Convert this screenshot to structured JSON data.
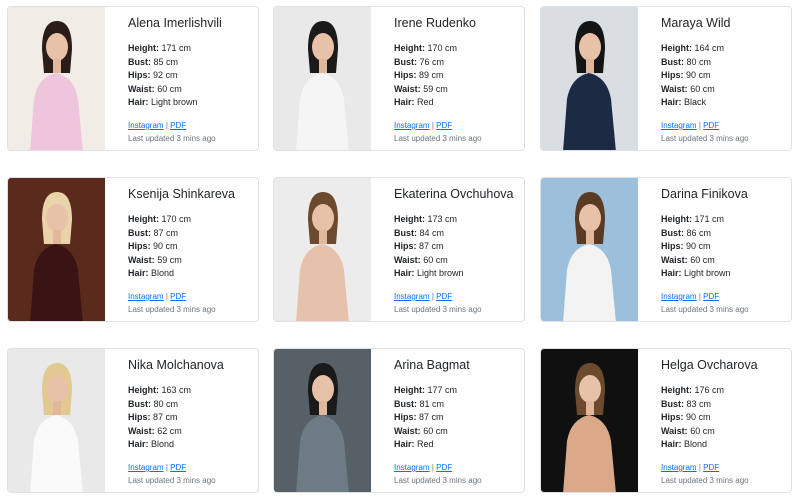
{
  "labels": {
    "height": "Height:",
    "bust": "Bust:",
    "hips": "Hips:",
    "waist": "Waist:",
    "hair": "Hair:",
    "instagram": "Instagram",
    "pdf": "PDF",
    "separator": "|"
  },
  "models": [
    {
      "name": "Alena Imerlishvili",
      "height": "171 cm",
      "bust": "85 cm",
      "hips": "92 cm",
      "waist": "60 cm",
      "hair": "Light brown",
      "updated": "Last updated 3 mins ago",
      "photo_bg": "#f1ece6",
      "photo_fg": "#efc5dd",
      "photo_hair": "#2a1d18"
    },
    {
      "name": "Irene Rudenko",
      "height": "170 cm",
      "bust": "76 cm",
      "hips": "89 cm",
      "waist": "59 cm",
      "hair": "Red",
      "updated": "Last updated 3 mins ago",
      "photo_bg": "#e9e9e9",
      "photo_fg": "#f5f5f5",
      "photo_hair": "#1a1a1a"
    },
    {
      "name": "Maraya Wild",
      "height": "164 cm",
      "bust": "80 cm",
      "hips": "90 cm",
      "waist": "60 cm",
      "hair": "Black",
      "updated": "Last updated 3 mins ago",
      "photo_bg": "#d9dee2",
      "photo_fg": "#1d2a44",
      "photo_hair": "#141414"
    },
    {
      "name": "Ksenija Shinkareva",
      "height": "170 cm",
      "bust": "87 cm",
      "hips": "90 cm",
      "waist": "59 cm",
      "hair": "Blond",
      "updated": "Last updated 3 mins ago",
      "photo_bg": "#5a2b1d",
      "photo_fg": "#3a1414",
      "photo_hair": "#e8d4a8"
    },
    {
      "name": "Ekaterina Ovchuhova",
      "height": "173 cm",
      "bust": "84 cm",
      "hips": "87 cm",
      "waist": "60 cm",
      "hair": "Light brown",
      "updated": "Last updated 3 mins ago",
      "photo_bg": "#ececec",
      "photo_fg": "#e6c2ad",
      "photo_hair": "#6b4a30"
    },
    {
      "name": "Darina Finikova",
      "height": "171 cm",
      "bust": "86 cm",
      "hips": "90 cm",
      "waist": "60 cm",
      "hair": "Light brown",
      "updated": "Last updated 3 mins ago",
      "photo_bg": "#9cc0dc",
      "photo_fg": "#f3f3f3",
      "photo_hair": "#5a3a22"
    },
    {
      "name": "Nika Molchanova",
      "height": "163 cm",
      "bust": "80 cm",
      "hips": "87 cm",
      "waist": "62 cm",
      "hair": "Blond",
      "updated": "Last updated 3 mins ago",
      "photo_bg": "#e9e9e9",
      "photo_fg": "#fafafa",
      "photo_hair": "#e1c98f"
    },
    {
      "name": "Arina Bagmat",
      "height": "177 cm",
      "bust": "81 cm",
      "hips": "87 cm",
      "waist": "60 cm",
      "hair": "Red",
      "updated": "Last updated 3 mins ago",
      "photo_bg": "#566066",
      "photo_fg": "#6d7b84",
      "photo_hair": "#1a1a1a"
    },
    {
      "name": "Helga Ovcharova",
      "height": "176 cm",
      "bust": "83 cm",
      "hips": "90 cm",
      "waist": "60 cm",
      "hair": "Blond",
      "updated": "Last updated 3 mins ago",
      "photo_bg": "#101010",
      "photo_fg": "#d9a98a",
      "photo_hair": "#6b4a2e"
    }
  ]
}
